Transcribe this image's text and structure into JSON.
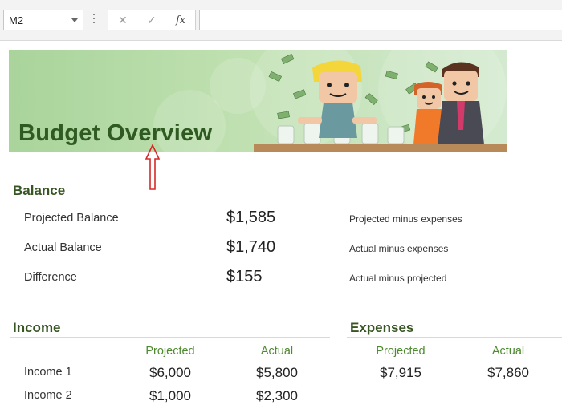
{
  "formula_bar": {
    "name_box": "M2",
    "cancel_icon": "✕",
    "enter_icon": "✓",
    "fx_icon": "fx",
    "formula": ""
  },
  "banner": {
    "title": "Budget Overview"
  },
  "balance": {
    "title": "Balance",
    "rows": [
      {
        "label": "Projected Balance",
        "amount": "$1,585",
        "note": "Projected minus expenses"
      },
      {
        "label": "Actual Balance",
        "amount": "$1,740",
        "note": "Actual minus expenses"
      },
      {
        "label": "Difference",
        "amount": "$155",
        "note": "Actual minus projected"
      }
    ]
  },
  "income": {
    "title": "Income",
    "col_projected": "Projected",
    "col_actual": "Actual",
    "rows": [
      {
        "label": "Income 1",
        "projected": "$6,000",
        "actual": "$5,800"
      },
      {
        "label": "Income 2",
        "projected": "$1,000",
        "actual": "$2,300"
      }
    ]
  },
  "expenses": {
    "title": "Expenses",
    "col_projected": "Projected",
    "col_actual": "Actual",
    "projected": "$7,915",
    "actual": "$7,860"
  },
  "colors": {
    "accent_green": "#375623",
    "header_green": "#4e8a30",
    "annotation_arrow": "#d62828"
  }
}
